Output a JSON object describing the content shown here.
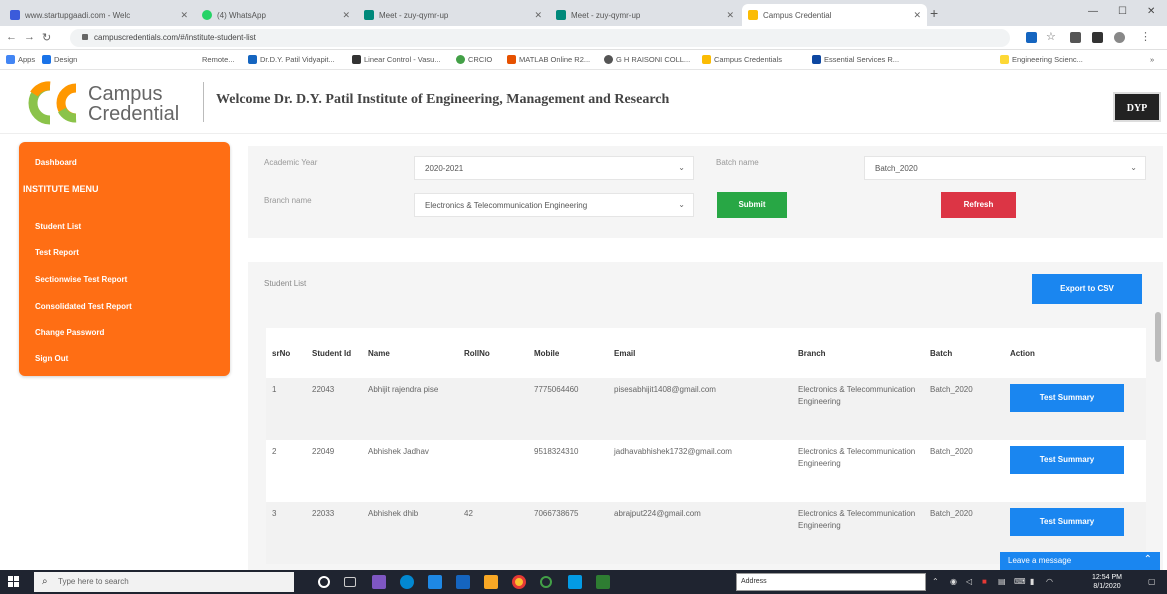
{
  "browser": {
    "tabs": [
      {
        "label": "www.startupgaadi.com - Welc",
        "color": "#3b5bdb",
        "active": false
      },
      {
        "label": "(4) WhatsApp",
        "color": "#25d366",
        "active": false
      },
      {
        "label": "Meet - zuy-qymr-up",
        "color": "#00897b",
        "active": false
      },
      {
        "label": "Meet - zuy-qymr-up",
        "color": "#00897b",
        "active": false
      },
      {
        "label": "Campus Credential",
        "color": "#fbbc04",
        "active": true
      }
    ],
    "url": "campuscredentials.com/#/institute-student-list",
    "bookmarks": [
      {
        "label": "Apps",
        "color": "#4285f4"
      },
      {
        "label": "Design",
        "color": "#1a73e8"
      },
      {
        "label": "Remote...",
        "color": "#888888"
      },
      {
        "label": "Dr.D.Y. Patil Vidyapit...",
        "color": "#1565c0"
      },
      {
        "label": "Linear Control - Vasu...",
        "color": "#333333"
      },
      {
        "label": "CRCIO",
        "color": "#43a047"
      },
      {
        "label": "MATLAB Online R2...",
        "color": "#e65100"
      },
      {
        "label": "G H RAISONI COLL...",
        "color": "#555555"
      },
      {
        "label": "Campus Credentials",
        "color": "#fbbc04"
      },
      {
        "label": "Essential Services R...",
        "color": "#0d47a1"
      },
      {
        "label": "Engineering Scienc...",
        "color": "#fdd835"
      }
    ]
  },
  "header": {
    "logo_line1": "Campus",
    "logo_line2": "Credential",
    "welcome": "Welcome Dr. D.Y. Patil Institute of Engineering, Management and Research",
    "badge": "DYP"
  },
  "sidebar": {
    "dashboard": "Dashboard",
    "menu_heading": "INSTITUTE MENU",
    "items": [
      "Student List",
      "Test Report",
      "Sectionwise Test Report",
      "Consolidated Test Report",
      "Change Password",
      "Sign Out"
    ]
  },
  "filter": {
    "academic_year_label": "Academic Year",
    "academic_year_value": "2020-2021",
    "batch_label": "Batch name",
    "batch_value": "Batch_2020",
    "branch_label": "Branch name",
    "branch_value": "Electronics & Telecommunication Engineering",
    "submit_label": "Submit",
    "refresh_label": "Refresh"
  },
  "list": {
    "title": "Student List",
    "export_label": "Export to CSV",
    "columns": [
      "srNo",
      "Student Id",
      "Name",
      "RollNo",
      "Mobile",
      "Email",
      "Branch",
      "Batch",
      "Action"
    ],
    "rows": [
      {
        "sr": "1",
        "id": "22043",
        "name": "Abhijit rajendra pise",
        "roll": "",
        "mobile": "7775064460",
        "email": "pisesabhijit1408@gmail.com",
        "branch": "Electronics & Telecommunication Engineering",
        "batch": "Batch_2020",
        "action": "Test Summary"
      },
      {
        "sr": "2",
        "id": "22049",
        "name": "Abhishek Jadhav",
        "roll": "",
        "mobile": "9518324310",
        "email": "jadhavabhishek1732@gmail.com",
        "branch": "Electronics & Telecommunication Engineering",
        "batch": "Batch_2020",
        "action": "Test Summary"
      },
      {
        "sr": "3",
        "id": "22033",
        "name": "Abhishek dhib",
        "roll": "42",
        "mobile": "7066738675",
        "email": "abrajput224@gmail.com",
        "branch": "Electronics & Telecommunication Engineering",
        "batch": "Batch_2020",
        "action": "Test Summary"
      }
    ]
  },
  "chat": {
    "label": "Leave a message"
  },
  "taskbar": {
    "search_placeholder": "Type here to search",
    "address_label": "Address",
    "time": "12:54 PM",
    "date": "8/1/2020"
  }
}
